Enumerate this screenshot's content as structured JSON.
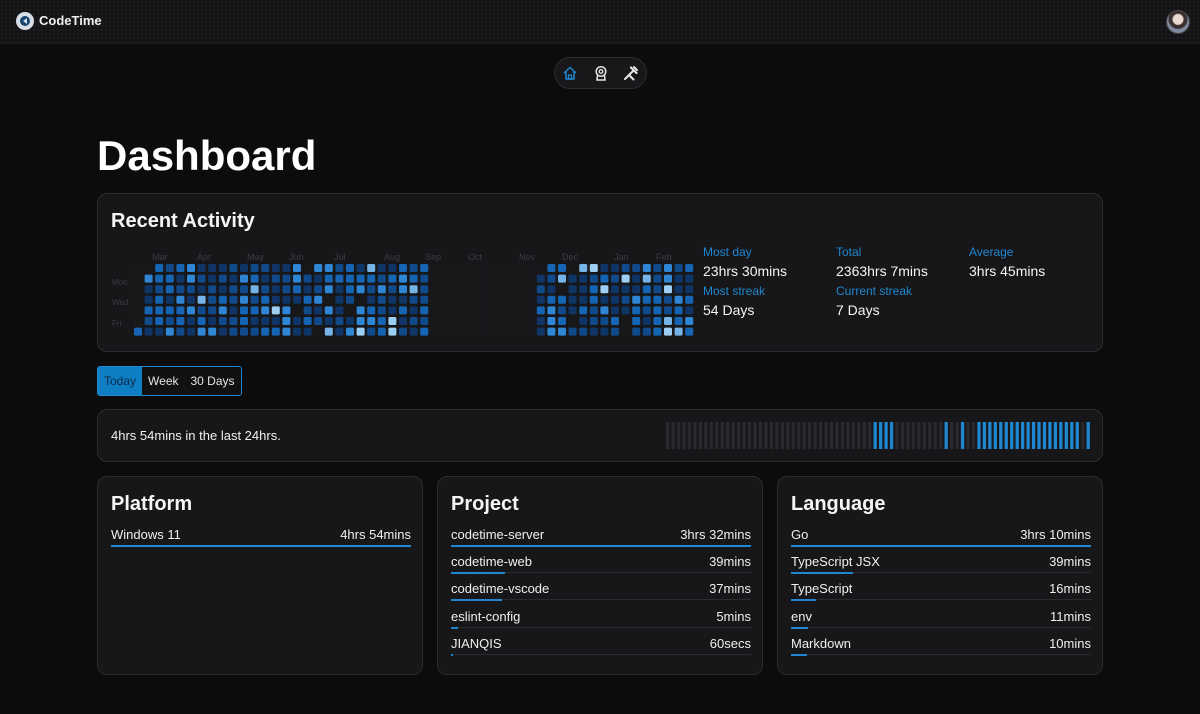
{
  "app": {
    "name": "CodeTime"
  },
  "nav": {
    "items": [
      "home-icon",
      "award-icon",
      "tools-icon"
    ],
    "active": "home-icon"
  },
  "page": {
    "title": "Dashboard"
  },
  "recent_activity": {
    "title": "Recent Activity",
    "months": [
      "Mar",
      "Apr",
      "May",
      "Jun",
      "Jul",
      "Aug",
      "Sep",
      "Oct",
      "Nov",
      "Dec",
      "Jan",
      "Feb"
    ],
    "days": [
      "Mon",
      "Wed",
      "Fri"
    ],
    "colors": [
      "#18181b",
      "#0f3566",
      "#114a8a",
      "#1565b4",
      "#2f86d4",
      "#76b4e7",
      "#9dcff3"
    ],
    "stats": {
      "most_day_label": "Most day",
      "most_day_value": "23hrs 30mins",
      "total_label": "Total",
      "total_value": "2363hrs 7mins",
      "average_label": "Average",
      "average_value": "3hrs 45mins",
      "most_streak_label": "Most streak",
      "most_streak_value": "54 Days",
      "current_streak_label": "Current streak",
      "current_streak_value": "7 Days"
    }
  },
  "range_tabs": {
    "today": "Today",
    "week": "Week",
    "days30": "30 Days",
    "active": "today"
  },
  "timeline": {
    "summary": "4hrs 54mins in the last 24hrs.",
    "hours": [
      0,
      0,
      0,
      0,
      0,
      0,
      0,
      0,
      0,
      0,
      0,
      0,
      0,
      0,
      0,
      0,
      0,
      0,
      0,
      0,
      0,
      0,
      0,
      0,
      0,
      0,
      0,
      0,
      0,
      0,
      0,
      0,
      0,
      0,
      0,
      0,
      0,
      0,
      1,
      1,
      1,
      1,
      0,
      0,
      0,
      0,
      0,
      0,
      0,
      0,
      0,
      1,
      0,
      0,
      1,
      0,
      0,
      1,
      1,
      1,
      1,
      1,
      1,
      1,
      1,
      1,
      1,
      1,
      1,
      1,
      1,
      1,
      1,
      1,
      1,
      1,
      0,
      1
    ]
  },
  "platform": {
    "title": "Platform",
    "rows": [
      {
        "label": "Windows 11",
        "value": "4hrs 54mins",
        "fraction": 1.0
      }
    ]
  },
  "project": {
    "title": "Project",
    "rows": [
      {
        "label": "codetime-server",
        "value": "3hrs 32mins",
        "fraction": 1.0
      },
      {
        "label": "codetime-web",
        "value": "39mins",
        "fraction": 0.18
      },
      {
        "label": "codetime-vscode",
        "value": "37mins",
        "fraction": 0.17
      },
      {
        "label": "eslint-config",
        "value": "5mins",
        "fraction": 0.024
      },
      {
        "label": "JIANQIS",
        "value": "60secs",
        "fraction": 0.005
      }
    ]
  },
  "language": {
    "title": "Language",
    "rows": [
      {
        "label": "Go",
        "value": "3hrs 10mins",
        "fraction": 1.0
      },
      {
        "label": "TypeScript JSX",
        "value": "39mins",
        "fraction": 0.205
      },
      {
        "label": "TypeScript",
        "value": "16mins",
        "fraction": 0.084
      },
      {
        "label": "env",
        "value": "11mins",
        "fraction": 0.058
      },
      {
        "label": "Markdown",
        "value": "10mins",
        "fraction": 0.053
      }
    ]
  }
}
